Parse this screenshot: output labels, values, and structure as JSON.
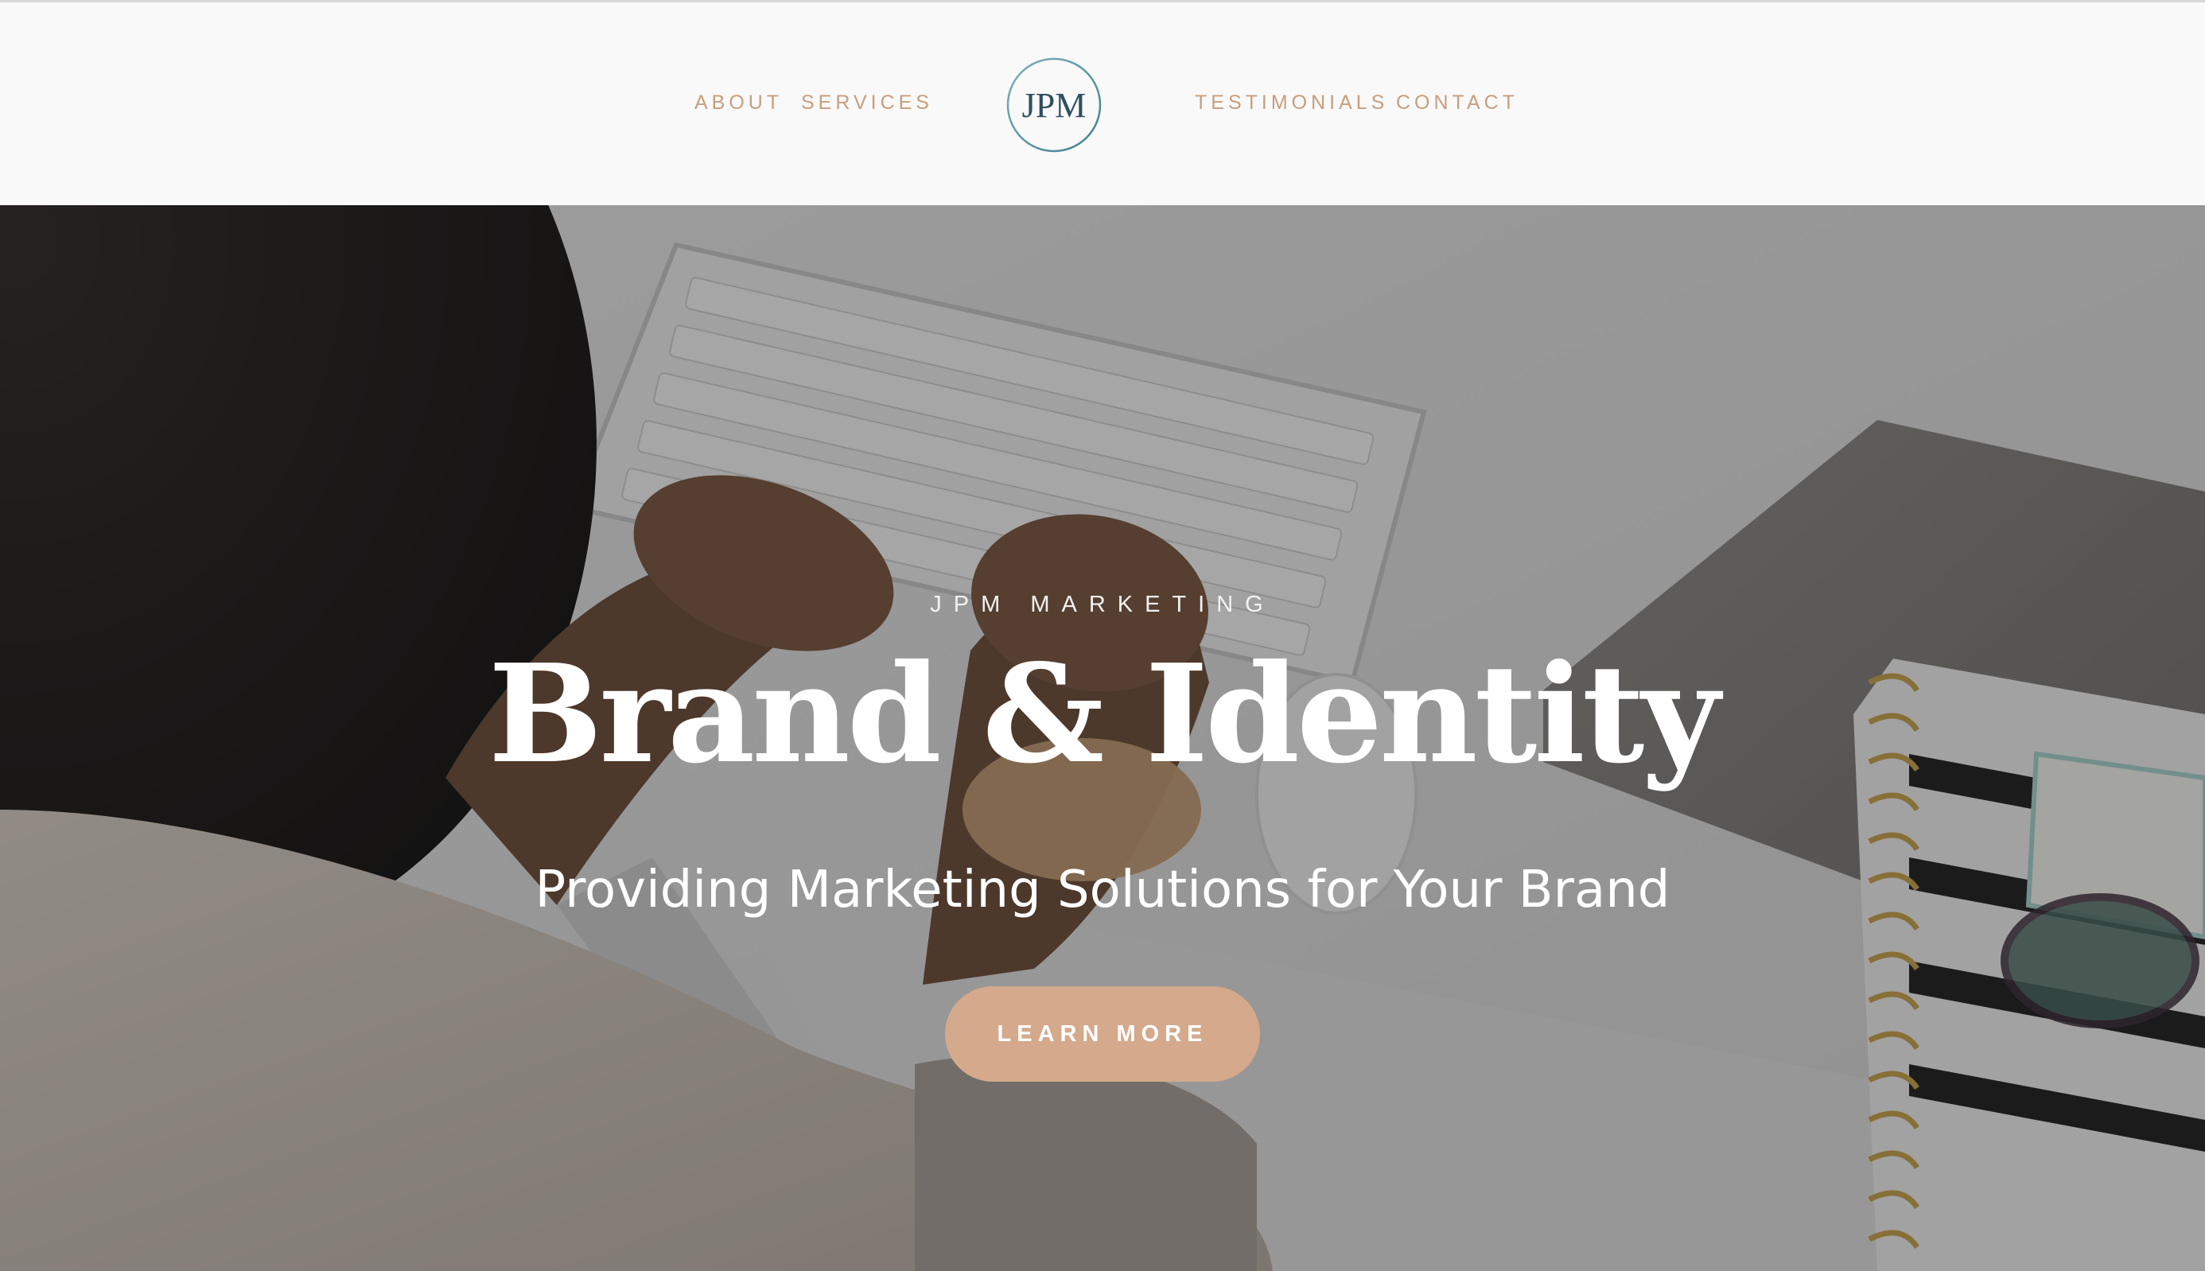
{
  "header": {
    "nav_left": [
      {
        "label": "ABOUT"
      },
      {
        "label": "SERVICES"
      }
    ],
    "logo": {
      "text": "JPM",
      "ring_color": "#5e9aa6",
      "text_color": "#2f4f5e"
    },
    "nav_right": [
      {
        "label": "TESTIMONIALS"
      },
      {
        "label": "CONTACT"
      }
    ],
    "link_color": "#c79e7d"
  },
  "hero": {
    "eyebrow": "JPM MARKETING",
    "headline": "Brand & Identity",
    "subheadline": "Providing Marketing Solutions for Your Brand",
    "cta_label": "LEARN MORE",
    "cta_color": "#d4a98c",
    "background_image": "photo of hands typing on a keyboard at a white desk with a laptop and striped spiral notebook"
  }
}
